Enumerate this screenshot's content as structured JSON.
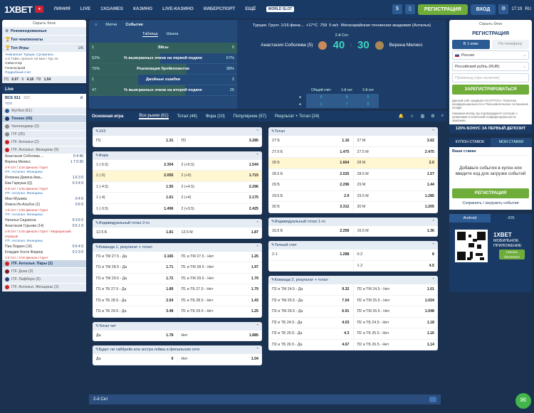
{
  "header": {
    "logo": "1XBET",
    "nav": [
      "ЛИНИЯ",
      "LIVE",
      "1XGAMES",
      "КАЗИНО",
      "LIVE-КАЗИНО",
      "КИБЕРСПОРТ",
      "ЕЩЁ"
    ],
    "promo": "WORLD SLOT",
    "register": "РЕГИСТРАЦИЯ",
    "login": "ВХОД",
    "time": "17:19",
    "lang": "RU"
  },
  "left": {
    "hide": "Скрыть блок",
    "menu": [
      {
        "label": "Рекомендованные",
        "icon": "☆"
      },
      {
        "label": "Топ чемпионаты",
        "icon": "🏆"
      },
      {
        "label": "Топ Игры",
        "icon": "🏆",
        "pager": "1/5"
      }
    ],
    "match": {
      "league": "Чемпионат Турции. Суперлига",
      "time": "1-й Тайм, прошло 18 мин / Тур 16",
      "team1": "Сивасспор",
      "team2": "Галатасарай",
      "more": "Подробный счет"
    },
    "odds": [
      "П1",
      "6.97",
      "X",
      "4.18",
      "П2",
      "1.54"
    ],
    "live": "Live",
    "all": "ВСЕ 811",
    "count": "322",
    "top": "ТОП",
    "sports": [
      {
        "label": "Футбол",
        "count": "(61)"
      },
      {
        "label": "Теннис",
        "count": "(40)"
      },
      {
        "label": "Челленджер",
        "count": "(3)"
      },
      {
        "label": "ITF",
        "count": "(25)"
      },
      {
        "label": "ITF. Анталья",
        "count": "(2)"
      },
      {
        "label": "ITF. Анталья. Женщины",
        "count": "(5)"
      }
    ],
    "games": [
      {
        "p1": "Анастасия Соболева ...",
        "p2": "Верена Мелисс",
        "s1": "0 4 40",
        "s2": "1 7 0 30",
        "status": "2-й Сет / 1/16 финала / Грунт"
      },
      {
        "h": "ITF. Анталья. Женщины",
        "p1": "Иллинка Дапина Ама...",
        "p2": "Ева Гаркуша (Q)",
        "s1": "1 6 3 0",
        "s2": "0 3 4 0",
        "status": "2-й Сет / 1/16 финала / Грунт"
      },
      {
        "h": "ITF. Анталья. Женщины",
        "p1": "Мию Мушика",
        "p2": "Илина Ин-Альбон (2)",
        "s1": "0 4 0",
        "s2": "0 6 0",
        "status": "1-й Сет / 1/16 финала / Грунт"
      },
      {
        "h": "ITF. Анталья. Женщины",
        "p1": "Наталья Сидлиска",
        "p2": "Анастасия Гурьева (14)",
        "s1": "0 3 6 0",
        "s2": "0 6 1 0",
        "status": "2-й Сет / 1/16 финала / Грунт / Медицинский перерыв"
      },
      {
        "h": "ITF. Анталья. Женщины",
        "p1": "Пиа Лоррин (16)",
        "p2": "Клаудия Хосте Феррер",
        "s1": "0 6 4 0",
        "s2": "0 2 3 0",
        "status": "2-й Сет / 1/16 финала / Грунт"
      }
    ],
    "bottom": [
      {
        "label": "ITF. Анталья. Пары",
        "count": "(2)"
      },
      {
        "label": "ITF. Доха",
        "count": "(3)"
      },
      {
        "label": "ITF. Лафборо",
        "count": "(5)"
      },
      {
        "label": "ITF. Анталья. Женщины",
        "count": "(2)"
      }
    ]
  },
  "scoreboard": {
    "tabs": [
      "Матчи",
      "Событие"
    ],
    "subtabs": [
      "Таблица",
      "Шкала"
    ],
    "stats": [
      {
        "a": "1",
        "n": "Эйсы",
        "b": "0",
        "fill": 1.0
      },
      {
        "a": "62%",
        "n": "% выигранных очков на первой подаче",
        "b": "67%",
        "fill": 0.48
      },
      {
        "a": "75%",
        "n": "Реализация брейкпоинтов",
        "b": "38%",
        "fill": 0.66
      },
      {
        "a": "1",
        "n": "Двойные ошибки",
        "b": "2",
        "fill": 0.33
      },
      {
        "a": "47",
        "n": "% выигранных очков на второй подаче",
        "b": "25",
        "fill": 0.65
      }
    ],
    "title": "Турция. Грунт. 1/16 фина...",
    "temp": "+17°C",
    "pressure": "759",
    "wind": "5 м/с",
    "venue": "Мегасарайская теннисная академия (Анталья)",
    "p1": "Анастасия Соболева (5)",
    "p2": "Верена Мелисс",
    "score1": "40",
    "score2": "30",
    "set": "2-й Сет",
    "table_heads": [
      "Общий счёт",
      "1-й сет",
      "2-й сет"
    ],
    "rows": [
      [
        "0",
        "5",
        "5"
      ],
      [
        "1",
        "7",
        "0"
      ]
    ]
  },
  "filters": {
    "main": "Основная игра",
    "items": [
      "Все рынки (61)",
      "Тотал (44)",
      "Фора (10)",
      "Популярное (57)",
      "Результат + Тотал (24)"
    ]
  },
  "markets_left": [
    {
      "title": "1X2",
      "rows": [
        [
          [
            "П1",
            "1.31"
          ],
          [
            "П2",
            "3.285"
          ]
        ]
      ]
    },
    {
      "title": "Фора",
      "rows": [
        [
          [
            "1 (-5.5)",
            "2.304"
          ],
          [
            "2 (+5.5)",
            "1.544"
          ]
        ],
        [
          [
            "1 (-5)",
            "2.055"
          ],
          [
            "2 (+5)",
            "1.715"
          ]
        ],
        [
          [
            "1 (-4.5)",
            "1.55"
          ],
          [
            "2 (+4.5)",
            "2.296"
          ]
        ],
        [
          [
            "1 (-4)",
            "1.61"
          ],
          [
            "2 (+4)",
            "2.175"
          ]
        ],
        [
          [
            "1 (-3.5)",
            "1.496"
          ],
          [
            "2 (+3.5)",
            "2.425"
          ]
        ]
      ]
    },
    {
      "title": "Индивидуальный тотал 2-го",
      "rows": [
        [
          [
            "12.5 Б",
            "1.81"
          ],
          [
            "12.5 М",
            "1.87"
          ]
        ]
      ]
    },
    {
      "title": "Команда 1, результат + тотал",
      "rows": [
        [
          [
            "П1 и ТМ 27.5 - Да",
            "3.165"
          ],
          [
            "П1 и ТМ 27.5 - Нет",
            "1.25"
          ]
        ],
        [
          [
            "П1 и ТМ 28.5 - Да",
            "1.71"
          ],
          [
            "П1 и ТМ 28.5 - Нет",
            "1.97"
          ]
        ],
        [
          [
            "П1 и ТМ 29.5 - Да",
            "1.72"
          ],
          [
            "П1 и ТМ 29.5 - Нет",
            "1.79"
          ]
        ],
        [
          [
            "П1 и ТБ 27.5 - Да",
            "1.89"
          ],
          [
            "П1 и ТБ 27.5 - Нет",
            "1.79"
          ]
        ],
        [
          [
            "П1 и ТБ 28.5 - Да",
            "2.54"
          ],
          [
            "П1 и ТБ 28.5 - Нет",
            "1.43"
          ]
        ],
        [
          [
            "П1 и ТБ 29.5 - Да",
            "3.48"
          ],
          [
            "П1 и ТБ 29.5 - Нет",
            "1.25"
          ]
        ]
      ]
    },
    {
      "title": "Тотал чет",
      "rows": [
        [
          [
            "Да",
            "1.78"
          ],
          [
            "Нет",
            "1.885"
          ]
        ]
      ]
    },
    {
      "title": "Будет ли тайбрейк или экстра геймы в финальном сете",
      "rows": [
        [
          [
            "Да",
            "9"
          ],
          [
            "Нет",
            "1.04"
          ]
        ]
      ]
    }
  ],
  "markets_right": [
    {
      "title": "Тотал",
      "rows": [
        [
          [
            "27 Б",
            "1.16"
          ],
          [
            "27 М",
            "3.62"
          ]
        ],
        [
          [
            "27.5 Б",
            "1.475"
          ],
          [
            "27.5 М",
            "2.475"
          ]
        ],
        [
          [
            "28 Б",
            "1.664"
          ],
          [
            "28 М",
            "2.0"
          ]
        ],
        [
          [
            "28.5 Б",
            "2.025"
          ],
          [
            "28.5 М",
            "1.57"
          ]
        ],
        [
          [
            "29 Б",
            "2.296"
          ],
          [
            "29 М",
            "1.44"
          ]
        ],
        [
          [
            "29.5 Б",
            "2.9"
          ],
          [
            "29.5 М",
            "1.285"
          ]
        ],
        [
          [
            "30 Б",
            "3.312"
          ],
          [
            "30 М",
            "1.205"
          ]
        ]
      ]
    },
    {
      "title": "Индивидуальный тотал 1-го",
      "rows": [
        [
          [
            "16.5 Б",
            "2.256"
          ],
          [
            "16.5 М",
            "1.36"
          ]
        ]
      ]
    },
    {
      "title": "Точный счет",
      "rows": [
        [
          [
            "2-1",
            "1.288"
          ],
          [
            "0-2",
            "8"
          ]
        ],
        [
          [
            "",
            ""
          ],
          [
            "1-2",
            "4.5"
          ]
        ]
      ]
    },
    {
      "title": "Команда 2, результат + тотал",
      "rows": [
        [
          [
            "П2 и ТМ 24.5 - Да",
            "9.32"
          ],
          [
            "П2 и ТМ 24.5 - Нет",
            "1.01"
          ]
        ],
        [
          [
            "П2 и ТМ 25.5 - Да",
            "7.54"
          ],
          [
            "П2 и ТМ 25.5 - Нет",
            "1.024"
          ]
        ],
        [
          [
            "П2 и ТМ 26.5 - Да",
            "6.91"
          ],
          [
            "П2 и ТМ 26.5 - Нет",
            "1.048"
          ]
        ],
        [
          [
            "П2 и ТБ 24.5 - Да",
            "4.03"
          ],
          [
            "П2 и ТБ 24.5 - Нет",
            "1.18"
          ]
        ],
        [
          [
            "П2 и ТБ 25.5 - Да",
            "4.3"
          ],
          [
            "П2 и ТБ 25.5 - Нет",
            "1.16"
          ]
        ],
        [
          [
            "П2 и ТБ 26.5 - Да",
            "4.67"
          ],
          [
            "П2 и ТБ 26.5 - Нет",
            "1.14"
          ]
        ]
      ]
    }
  ],
  "set2": "2-й Сет",
  "right": {
    "hide": "Скрыть блок",
    "title": "РЕГИСТРАЦИЯ",
    "tabs": [
      "В 1 клик",
      "По телефону"
    ],
    "country": "Россия",
    "currency": "Российский рубль (RUB)",
    "promo_placeholder": "Промокод (при наличии)",
    "register": "ЗАРЕГИСТРИРОВАТЬСЯ",
    "terms": "Данный сайт защищён reCAPTCHA. Политика конфиденциальности и Пользовательское соглашение Google",
    "agree": "Нажимая кнопку, вы подтверждаете согласие с правилами и политикой конфиденциальности компании",
    "bonus": "120% БОНУС ЗА ПЕРВЫЙ ДЕПОЗИТ",
    "coupon_tabs": [
      "КУПОН СТАВОК",
      "МОИ СТАВКИ"
    ],
    "your_bets": "Ваши ставки",
    "coupon_msg": "Добавьте события в купон или введите код для загрузки событий",
    "coupon_btn": "РЕГИСТРАЦИЯ",
    "coupon_link": "Сохранить / загрузить события",
    "app_tabs": [
      "Android",
      "iOS"
    ],
    "app_title": "1XBET",
    "app_sub": "МОБИЛЬНОЕ ПРИЛОЖЕНИЕ",
    "app_btn": "Скачать бесплатно"
  }
}
